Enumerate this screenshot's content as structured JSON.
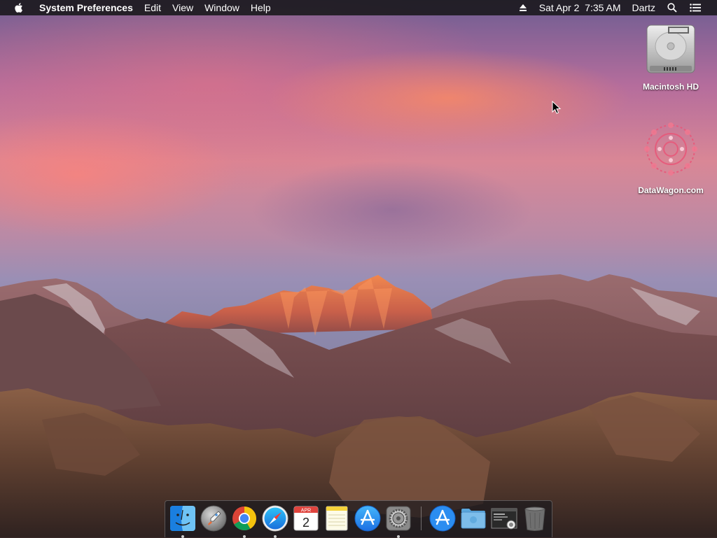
{
  "menubar": {
    "apple_icon": "apple-logo-icon",
    "app_name": "System Preferences",
    "menus": [
      "Edit",
      "View",
      "Window",
      "Help"
    ],
    "eject_icon": "eject-icon",
    "clock": "Sat Apr 2  7:35 AM",
    "user": "Dartz",
    "spotlight_icon": "search-icon",
    "notification_icon": "list-icon"
  },
  "desktop": {
    "icons": [
      {
        "label": "Macintosh HD",
        "icon": "hard-drive-icon"
      },
      {
        "label": "DataWagon.com",
        "icon": "mandala-logo-icon"
      }
    ],
    "cursor_icon": "arrow-cursor-icon"
  },
  "dock": {
    "apps": [
      {
        "name": "Finder",
        "icon": "finder-icon",
        "running": true
      },
      {
        "name": "Launchpad",
        "icon": "launchpad-rocket-icon",
        "running": false
      },
      {
        "name": "Google Chrome",
        "icon": "chrome-icon",
        "running": true
      },
      {
        "name": "Safari",
        "icon": "safari-compass-icon",
        "running": true
      },
      {
        "name": "Calendar",
        "icon": "calendar-icon",
        "running": false,
        "month": "APR",
        "day": "2"
      },
      {
        "name": "Notes",
        "icon": "notes-icon",
        "running": false
      },
      {
        "name": "App Store",
        "icon": "app-store-icon",
        "running": false
      },
      {
        "name": "System Preferences",
        "icon": "gear-icon",
        "running": true
      }
    ],
    "stacks": [
      {
        "name": "Applications",
        "icon": "app-store-icon"
      },
      {
        "name": "Downloads",
        "icon": "folder-icon"
      },
      {
        "name": "Screenshot",
        "icon": "screenshot-thumbnail-icon"
      },
      {
        "name": "Trash",
        "icon": "trash-icon"
      }
    ]
  },
  "colors": {
    "menubar_bg": "#1c1a20",
    "chrome_red": "#db4437",
    "chrome_yellow": "#f4c20d",
    "chrome_green": "#0f9d58",
    "chrome_blue": "#4285f4",
    "app_store_blue": "#1e8ef0"
  }
}
